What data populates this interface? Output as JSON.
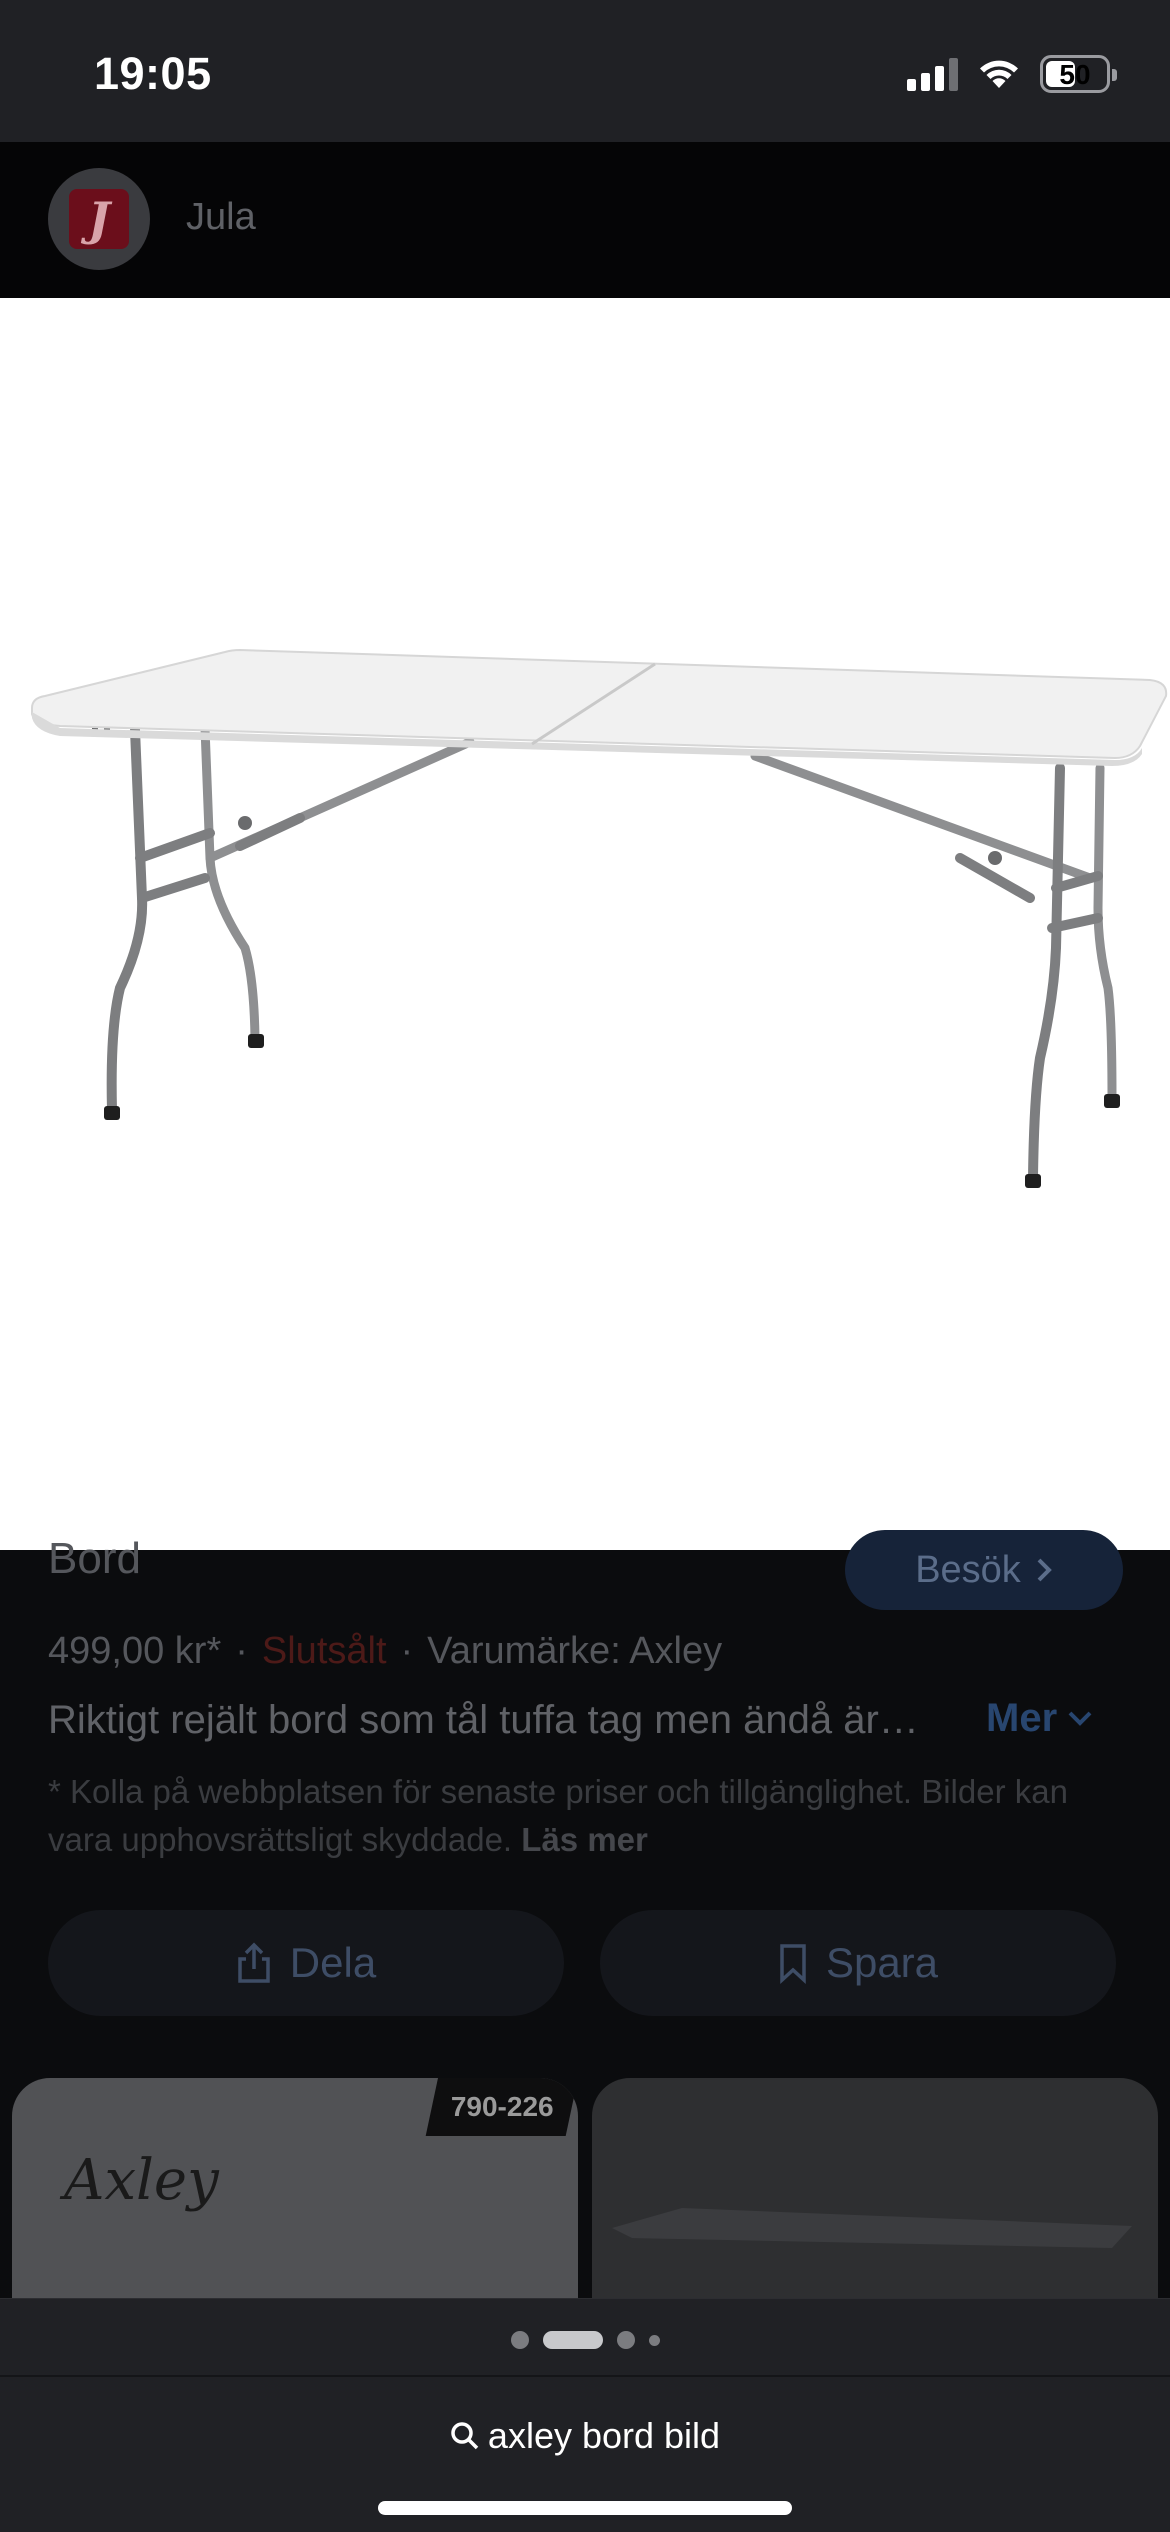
{
  "status_bar": {
    "time": "19:05",
    "battery_level": "50",
    "battery_fraction": 0.5,
    "signal_bars_filled": 3,
    "signal_bars_total": 4
  },
  "source": {
    "logo_letter": "J",
    "name": "Jula"
  },
  "product": {
    "title": "Bord",
    "visit_label": "Besök",
    "price": "499,00 kr*",
    "availability": "Slutsålt",
    "brand": "Varumärke: Axley",
    "description": "Riktigt rejält bord som tål tuffa tag men ändå är…",
    "more_label": "Mer",
    "disclaimer": "* Kolla på webbplatsen för senaste priser och tillgänglighet. Bilder kan vara upphovsrättsligt skyddade.",
    "read_more_label": "Läs mer"
  },
  "actions": {
    "share_label": "Dela",
    "save_label": "Spara"
  },
  "related": {
    "card1_badge": "790-226",
    "card1_brand": "Axley"
  },
  "pager": {
    "total": 4,
    "active_index": 1
  },
  "search": {
    "query": "axley bord bild"
  },
  "colors": {
    "status_bar_bg": "#202125",
    "link_blue": "#8ab4f8",
    "sold_out_red": "#d93025"
  }
}
